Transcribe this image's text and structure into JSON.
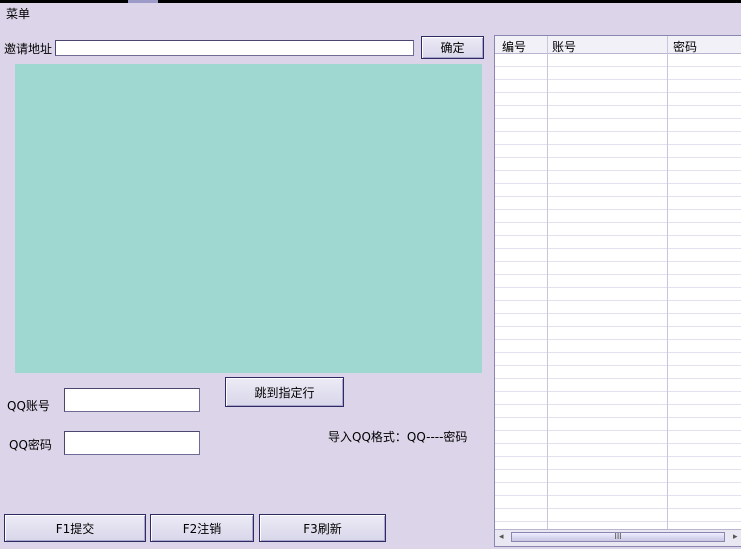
{
  "menu": {
    "label": "菜单"
  },
  "invite": {
    "label": "邀请地址",
    "value": "",
    "confirm_label": "确定"
  },
  "jump": {
    "label": "跳到指定行"
  },
  "qq": {
    "account_label": "QQ账号",
    "account_value": "",
    "password_label": "QQ密码",
    "password_value": ""
  },
  "import_hint": "导入QQ格式：QQ----密码",
  "buttons": {
    "submit": "F1提交",
    "logout": "F2注销",
    "refresh": "F3刷新"
  },
  "table": {
    "columns": [
      "编号",
      "账号",
      "密码"
    ]
  },
  "scrollbar": {
    "left": "◂",
    "right": "▸",
    "thumb": "III"
  }
}
